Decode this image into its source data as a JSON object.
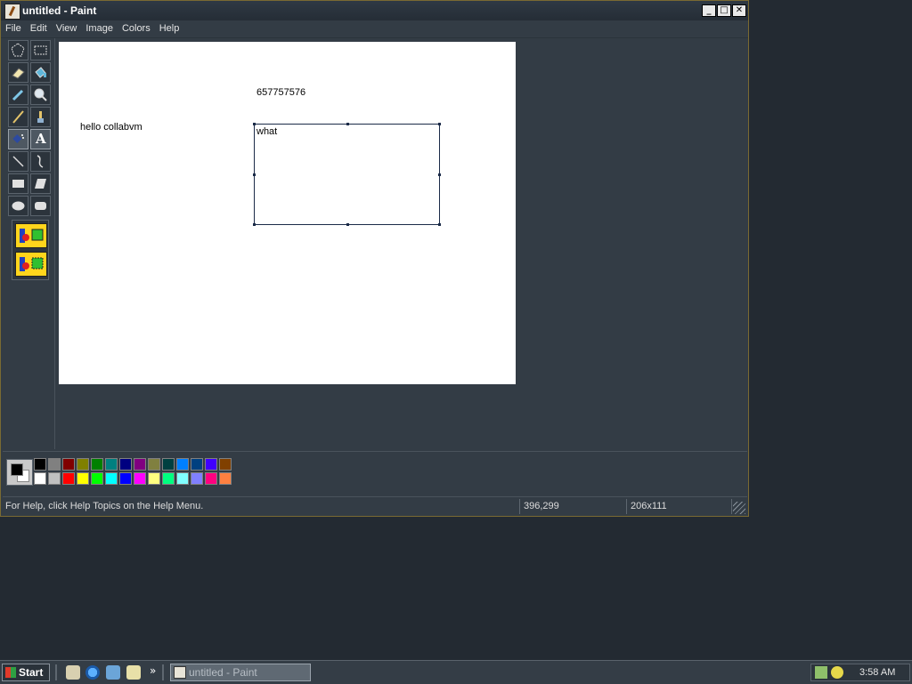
{
  "window": {
    "title": "untitled - Paint",
    "caption_buttons": {
      "minimize": "_",
      "maximize": "□",
      "close": "✕"
    }
  },
  "menu": [
    "File",
    "Edit",
    "View",
    "Image",
    "Colors",
    "Help"
  ],
  "tools": [
    {
      "name": "free-select-icon"
    },
    {
      "name": "rect-select-icon"
    },
    {
      "name": "eraser-icon"
    },
    {
      "name": "fill-bucket-icon"
    },
    {
      "name": "color-picker-icon"
    },
    {
      "name": "magnifier-icon"
    },
    {
      "name": "pencil-icon"
    },
    {
      "name": "brush-icon"
    },
    {
      "name": "airbrush-icon",
      "active": true
    },
    {
      "name": "text-tool-icon",
      "label": "A",
      "active": true
    },
    {
      "name": "line-icon"
    },
    {
      "name": "curve-icon"
    },
    {
      "name": "rectangle-icon"
    },
    {
      "name": "polygon-icon"
    },
    {
      "name": "ellipse-icon"
    },
    {
      "name": "rounded-rect-icon"
    }
  ],
  "canvas": {
    "texts": {
      "number": "657757576",
      "hello": "hello collabvm",
      "textbox_content": "what"
    }
  },
  "palette": {
    "foreground": "#000000",
    "background": "#ffffff",
    "top_row": [
      "#000000",
      "#808080",
      "#800000",
      "#808000",
      "#008000",
      "#008080",
      "#000080",
      "#800080",
      "#808040",
      "#004040",
      "#0080ff",
      "#004080",
      "#4000ff",
      "#804000"
    ],
    "bottom_row": [
      "#ffffff",
      "#c0c0c0",
      "#ff0000",
      "#ffff00",
      "#00ff00",
      "#00ffff",
      "#0000ff",
      "#ff00ff",
      "#ffff80",
      "#00ff80",
      "#80ffff",
      "#8080ff",
      "#ff0080",
      "#ff8040"
    ]
  },
  "status": {
    "help": "For Help, click Help Topics on the Help Menu.",
    "coords": "396,299",
    "size": "206x111"
  },
  "taskbar": {
    "start": "Start",
    "task": "untitled - Paint",
    "clock": "3:58 AM",
    "quicklaunch_more": "»"
  }
}
